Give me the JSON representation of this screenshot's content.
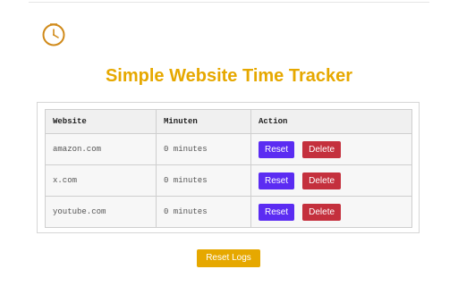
{
  "icon": "clock-icon",
  "colors": {
    "accent": "#e6a800",
    "reset_button": "#5b2cf2",
    "delete_button": "#c4303d"
  },
  "title": "Simple Website Time Tracker",
  "table": {
    "headers": [
      "Website",
      "Minuten",
      "Action"
    ],
    "rows": [
      {
        "website": "amazon.com",
        "minutes": "0 minutes",
        "reset_label": "Reset",
        "delete_label": "Delete"
      },
      {
        "website": "x.com",
        "minutes": "0 minutes",
        "reset_label": "Reset",
        "delete_label": "Delete"
      },
      {
        "website": "youtube.com",
        "minutes": "0 minutes",
        "reset_label": "Reset",
        "delete_label": "Delete"
      }
    ]
  },
  "reset_logs_label": "Reset Logs"
}
